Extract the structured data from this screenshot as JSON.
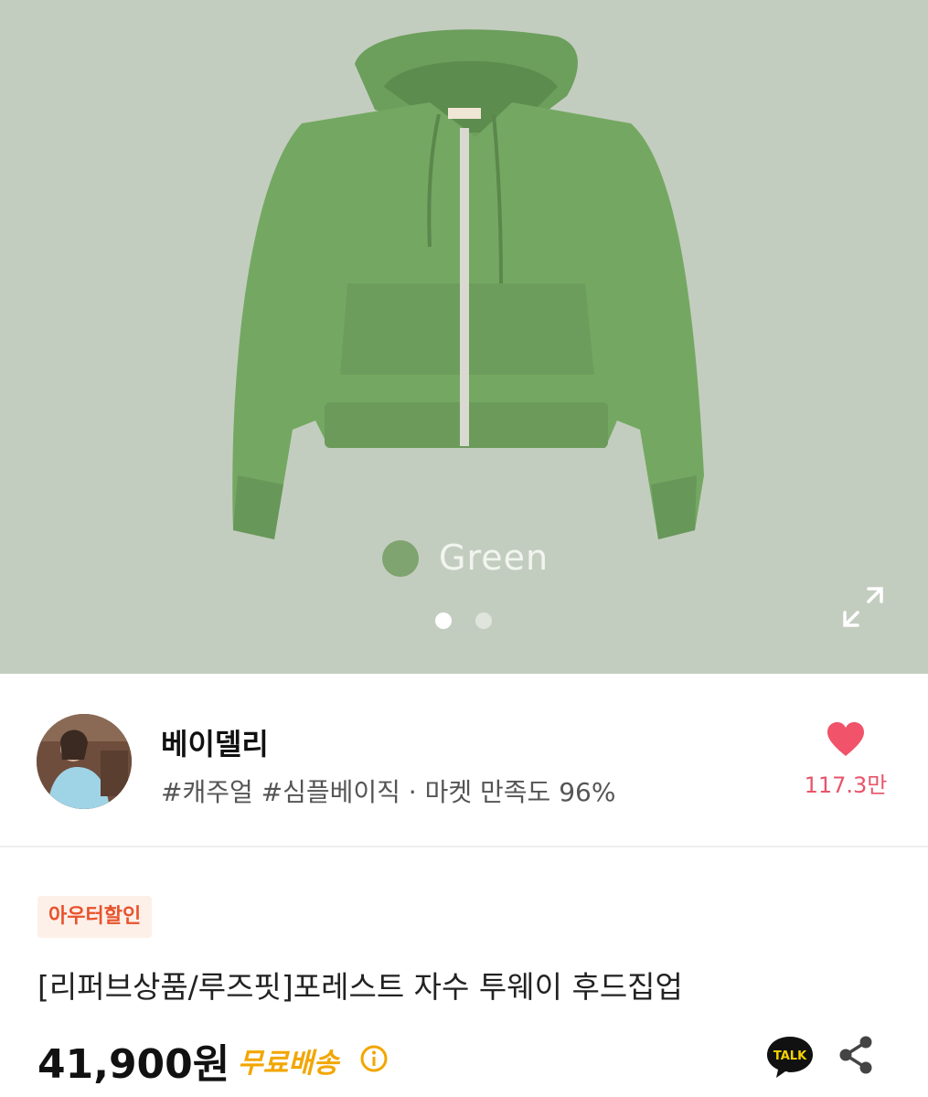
{
  "gallery": {
    "color_name": "Green",
    "color_hex": "#7fa470",
    "background_hex": "#c3cdbf",
    "page_dots": 2,
    "active_dot": 1,
    "expand_icon": "expand-icon"
  },
  "seller": {
    "name": "베이델리",
    "tags": "#캐주얼 #심플베이직 · 마켓 만족도 96%",
    "like_count": "117.3만",
    "like_icon": "heart-icon"
  },
  "product": {
    "badge": "아우터할인",
    "title": "[리퍼브상품/루즈핏]포레스트 자수 투웨이 후드집업",
    "price": "41,900원",
    "shipping": "무료배송",
    "accent_color": "#f2a600",
    "talk_label": "TALK"
  }
}
